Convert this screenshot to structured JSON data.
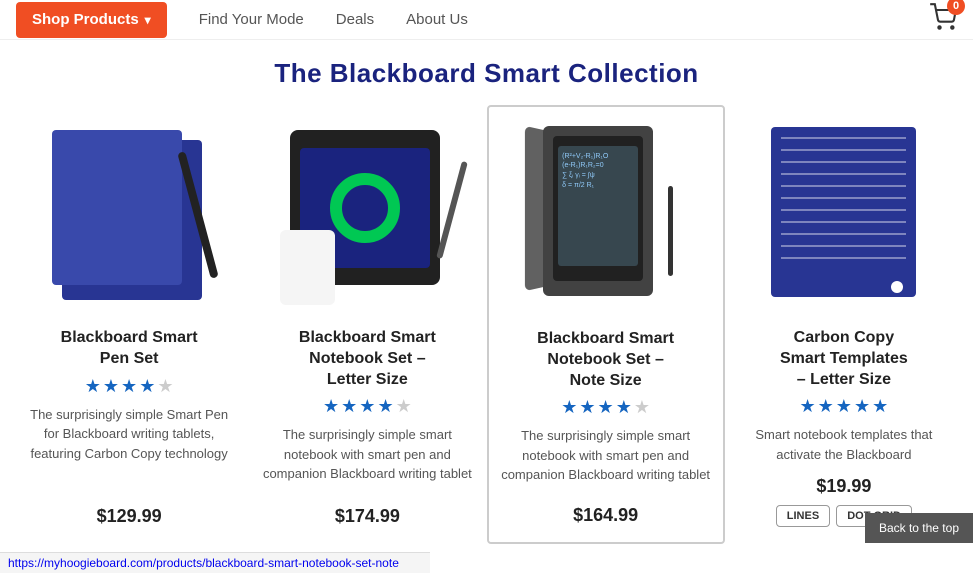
{
  "nav": {
    "shop_label": "Shop Products",
    "find_label": "Find Your Mode",
    "deals_label": "Deals",
    "about_label": "About Us",
    "cart_count": "0"
  },
  "hero": {
    "title": "The Blackboard Smart Collection"
  },
  "products": [
    {
      "id": "pen-set",
      "name": "Blackboard Smart Pen Set",
      "stars": 4,
      "max_stars": 5,
      "description": "The surprisingly simple Smart Pen for Blackboard writing tablets, featuring Carbon Copy technology",
      "price": "$129.99",
      "highlighted": false,
      "has_variants": false
    },
    {
      "id": "notebook-letter",
      "name": "Blackboard Smart Notebook Set – Letter Size",
      "stars": 4,
      "max_stars": 5,
      "description": "The surprisingly simple smart notebook with smart pen and companion Blackboard writing tablet",
      "price": "$174.99",
      "price_prefix": "",
      "highlighted": false,
      "has_variants": false,
      "price_cut": true
    },
    {
      "id": "notebook-note",
      "name": "Blackboard Smart Notebook Set – Note Size",
      "stars": 4,
      "max_stars": 5,
      "description": "The surprisingly simple smart notebook with smart pen and companion Blackboard writing tablet",
      "price": "$164.99",
      "highlighted": true,
      "has_variants": false
    },
    {
      "id": "carbon",
      "name": "Carbon Copy Smart Templates – Letter Size",
      "stars": 5,
      "max_stars": 5,
      "description": "Smart notebook templates that activate the Blackboard",
      "price": "$19.99",
      "highlighted": false,
      "has_variants": true,
      "variants": [
        "LINES",
        "DOT GRID"
      ]
    }
  ],
  "back_to_top": "Back to the top",
  "status_url": "https://myhoogieboard.com/products/blackboard-smart-notebook-set-note"
}
